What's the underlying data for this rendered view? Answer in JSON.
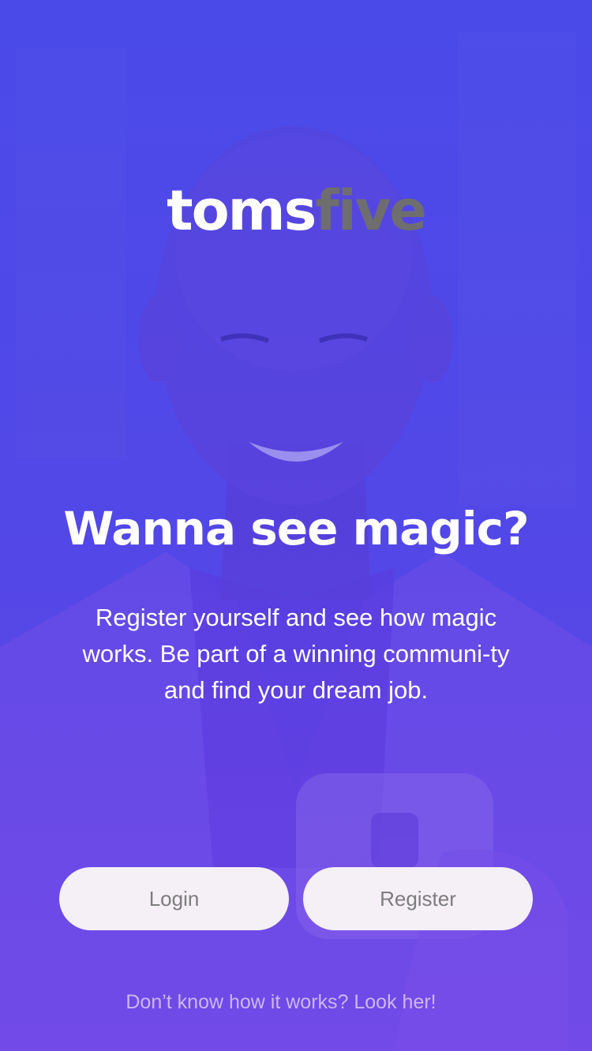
{
  "brand": {
    "logo_part1": "toms",
    "logo_part2": "five"
  },
  "hero": {
    "headline": "Wanna see magic?",
    "subtext": "Register yourself and see how magic works. Be part of a winning communi-ty and find your dream job."
  },
  "actions": {
    "login_label": "Login",
    "register_label": "Register"
  },
  "footer": {
    "help_link": "Don’t know how it works? Look her!"
  },
  "colors": {
    "gradient_top": "#4a4be8",
    "gradient_bottom": "#7a48e8",
    "button_bg": "#f5eff6",
    "button_text": "#7d7d7d",
    "logo_accent": "#6e6e6e",
    "link_text": "#cdb6ee"
  }
}
